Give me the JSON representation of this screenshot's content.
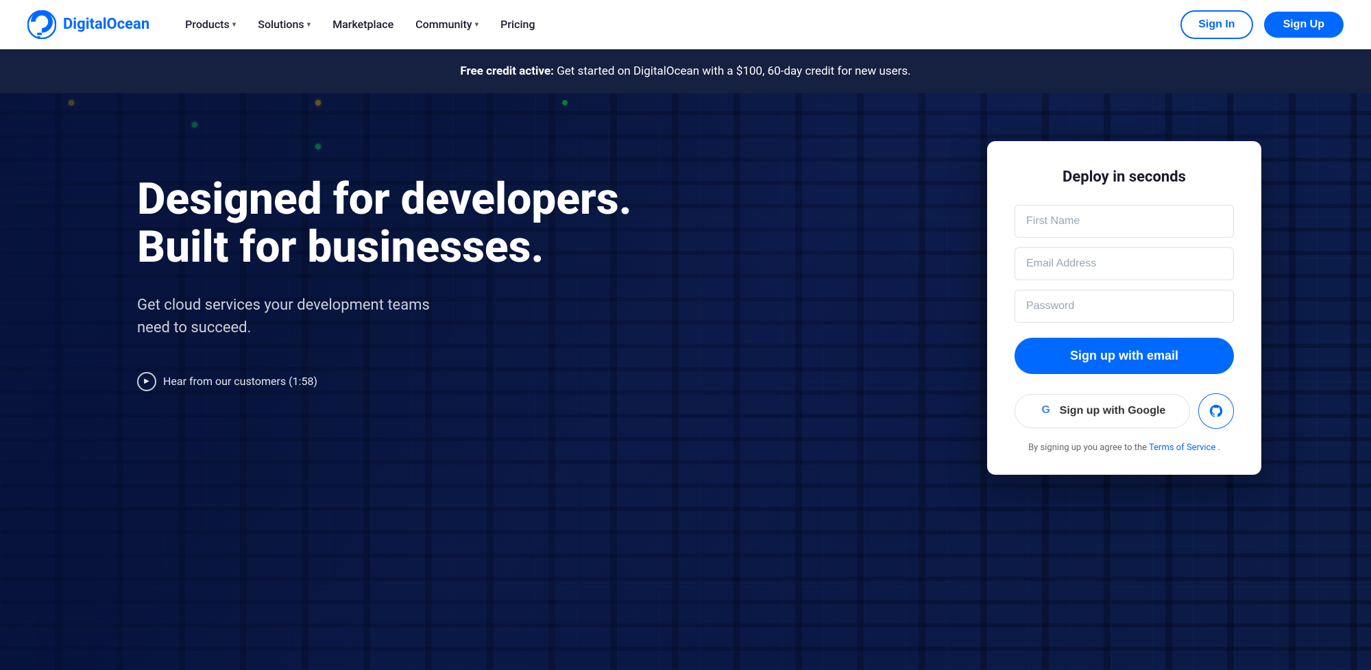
{
  "navbar": {
    "logo_text": "DigitalOcean",
    "nav_items": [
      {
        "label": "Products",
        "has_dropdown": true
      },
      {
        "label": "Solutions",
        "has_dropdown": true
      },
      {
        "label": "Marketplace",
        "has_dropdown": false
      },
      {
        "label": "Community",
        "has_dropdown": true
      },
      {
        "label": "Pricing",
        "has_dropdown": false
      }
    ],
    "signin_label": "Sign In",
    "signup_label": "Sign Up"
  },
  "banner": {
    "bold_text": "Free credit active:",
    "text": " Get started on DigitalOcean with a $100, 60-day credit for new users."
  },
  "hero": {
    "heading_line1": "Designed for developers.",
    "heading_line2": "Built for businesses.",
    "subtitle": "Get cloud services your development teams need to succeed.",
    "video_link": "Hear from our customers (1:58)"
  },
  "signup_card": {
    "title": "Deploy in seconds",
    "first_name_placeholder": "First Name",
    "email_placeholder": "Email Address",
    "password_placeholder": "Password",
    "email_button": "Sign up with email",
    "google_button": "Sign up with Google",
    "terms_text": "By signing up you agree to the Terms of Service."
  },
  "colors": {
    "primary": "#0069ff",
    "dark": "#1a1a2e",
    "white": "#ffffff"
  }
}
